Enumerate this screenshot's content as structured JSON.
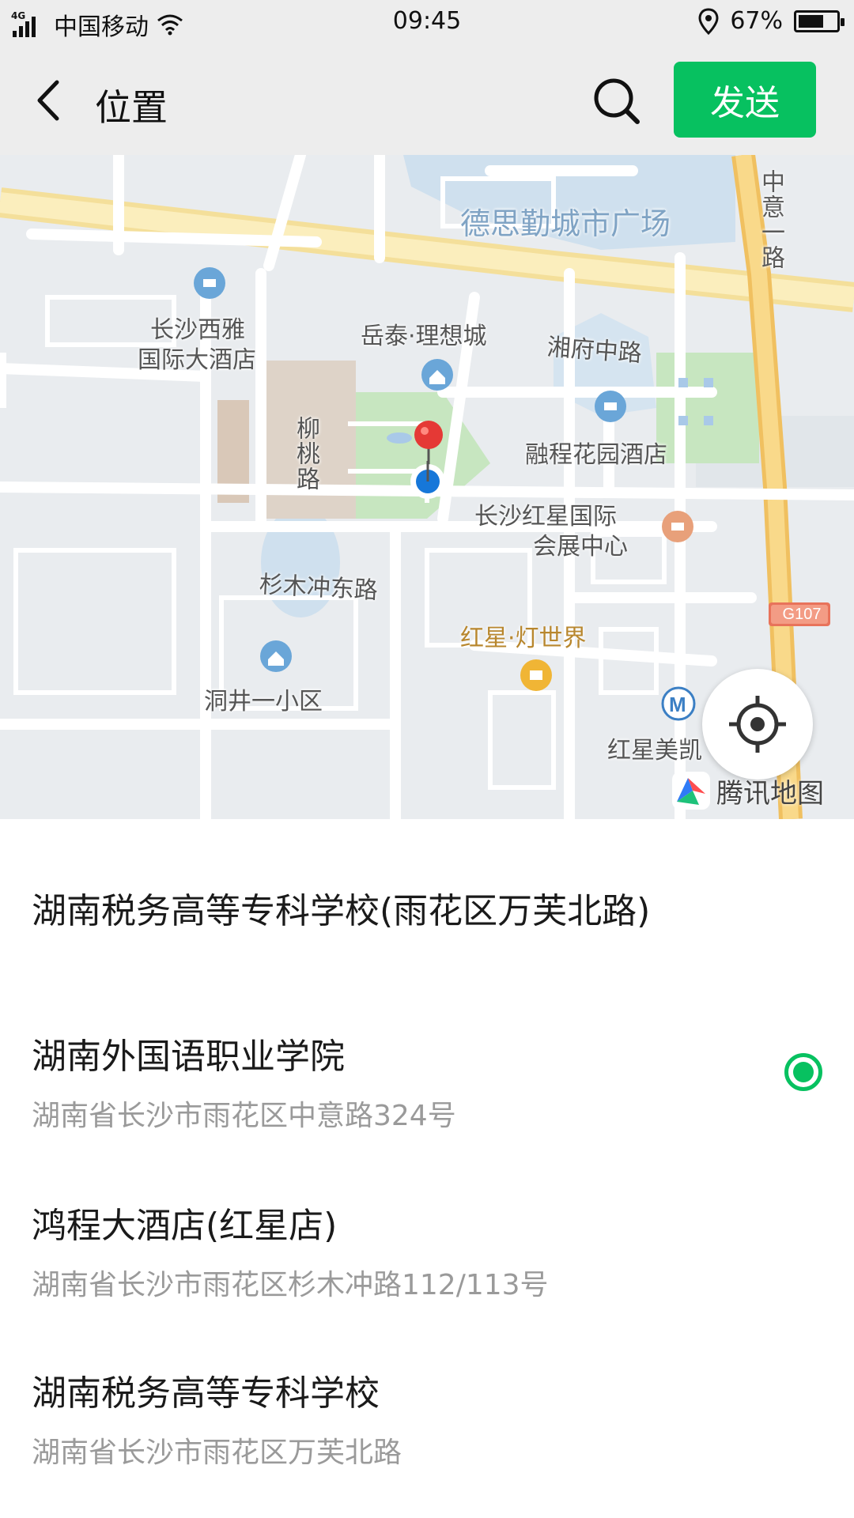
{
  "status_bar": {
    "network": "4G",
    "carrier": "中国移动",
    "time": "09:45",
    "battery": "67%",
    "battery_level": 0.67
  },
  "navbar": {
    "back_icon": "chevron-left-icon",
    "title": "位置",
    "search_icon": "search-icon",
    "send_label": "发送",
    "send_color": "#07c160"
  },
  "map": {
    "labels": {
      "desi": "德思勤城市广场",
      "zhongyi": "中意一路",
      "xiya": "长沙西雅",
      "xiya2": "国际大酒店",
      "yuetai": "岳泰·理想城",
      "xiangfu": "湘府中路",
      "liutao": "柳桃路",
      "rongcheng": "融程花园酒店",
      "hongxing": "长沙红星国际",
      "hongxing2": "会展中心",
      "shanmu": "杉木冲东路",
      "dengshijie": "红星·灯世界",
      "g107": "G107",
      "dongjing": "洞井一小区",
      "hongxingmei": "红星美凯",
      "watermark": "腾讯地图"
    },
    "locate_icon": "crosshair-icon"
  },
  "list": [
    {
      "title": "湖南税务高等专科学校(雨花区万芙北路)",
      "subtitle": "",
      "selected": false
    },
    {
      "title": "湖南外国语职业学院",
      "subtitle": "湖南省长沙市雨花区中意路324号",
      "selected": true
    },
    {
      "title": "鸿程大酒店(红星店)",
      "subtitle": "湖南省长沙市雨花区杉木冲路112/113号",
      "selected": false
    },
    {
      "title": "湖南税务高等专科学校",
      "subtitle": "湖南省长沙市雨花区万芙北路",
      "selected": false
    }
  ]
}
